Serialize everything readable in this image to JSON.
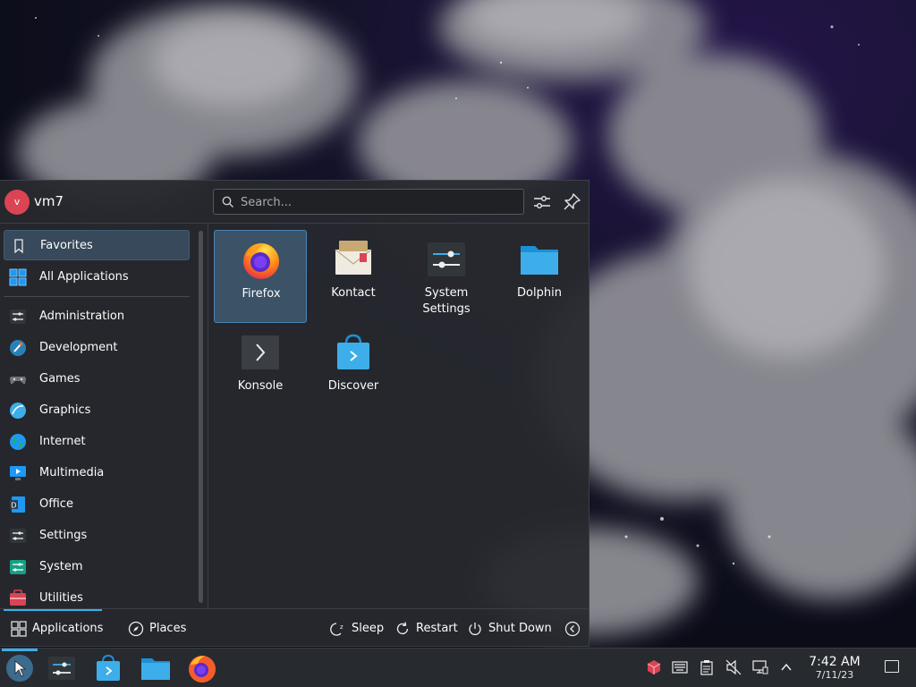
{
  "user": {
    "avatar_initial": "v",
    "name": "vm7"
  },
  "search": {
    "placeholder": "Search..."
  },
  "sidebar": {
    "items": [
      {
        "label": "Favorites",
        "icon": "bookmark-icon"
      },
      {
        "label": "All Applications",
        "icon": "grid-icon"
      },
      {
        "label": "Administration",
        "icon": "administration-icon"
      },
      {
        "label": "Development",
        "icon": "development-icon"
      },
      {
        "label": "Games",
        "icon": "gamepad-icon"
      },
      {
        "label": "Graphics",
        "icon": "graphics-icon"
      },
      {
        "label": "Internet",
        "icon": "globe-icon"
      },
      {
        "label": "Multimedia",
        "icon": "multimedia-icon"
      },
      {
        "label": "Office",
        "icon": "office-icon"
      },
      {
        "label": "Settings",
        "icon": "settings-icon"
      },
      {
        "label": "System",
        "icon": "system-icon"
      },
      {
        "label": "Utilities",
        "icon": "utilities-icon"
      }
    ],
    "active": "Favorites"
  },
  "favorites": [
    {
      "label": "Firefox",
      "icon": "firefox-icon"
    },
    {
      "label": "Kontact",
      "icon": "kontact-icon"
    },
    {
      "label": "System\nSettings",
      "icon": "system-settings-icon"
    },
    {
      "label": "Dolphin",
      "icon": "folder-icon"
    },
    {
      "label": "Konsole",
      "icon": "terminal-icon"
    },
    {
      "label": "Discover",
      "icon": "store-icon"
    }
  ],
  "footer": {
    "tabs": [
      {
        "label": "Applications",
        "icon": "grid-icon"
      },
      {
        "label": "Places",
        "icon": "compass-icon"
      }
    ],
    "active_tab": "Applications",
    "power": [
      {
        "label": "Sleep",
        "icon": "sleep-icon"
      },
      {
        "label": "Restart",
        "icon": "restart-icon"
      },
      {
        "label": "Shut Down",
        "icon": "power-icon"
      }
    ]
  },
  "taskbar": {
    "tasks": [
      "app-launcher-icon",
      "system-settings-icon",
      "discover-icon",
      "dolphin-icon",
      "firefox-icon"
    ],
    "tray": [
      "package-icon",
      "keyboard-icon",
      "clipboard-icon",
      "volume-muted-icon",
      "network-icon",
      "chevron-up-icon"
    ],
    "clock": {
      "time": "7:42 AM",
      "date": "7/11/23"
    }
  },
  "colors": {
    "accent": "#3daee9",
    "avatar": "#da4453",
    "panel": "#272a2f"
  }
}
